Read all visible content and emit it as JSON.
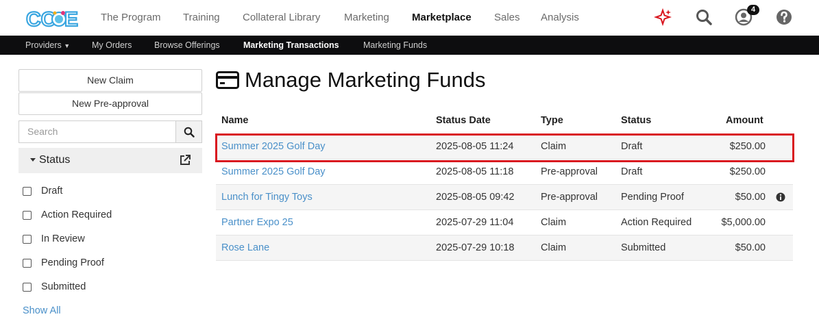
{
  "brand": {
    "logo_text": "CCoE",
    "logo_colors": [
      "#3aa6e0",
      "#e0337a",
      "#f2b01e",
      "#5cc0e8"
    ]
  },
  "topnav": {
    "items": [
      "The Program",
      "Training",
      "Collateral Library",
      "Marketing",
      "Marketplace",
      "Sales",
      "Analysis"
    ],
    "active": "Marketplace",
    "notifications_count": "4",
    "icons": [
      "sparkle-icon",
      "search-icon",
      "user-icon",
      "help-icon"
    ],
    "accent_color": "#d9161f"
  },
  "subnav": {
    "items": [
      "Providers",
      "My Orders",
      "Browse Offerings",
      "Marketing Transactions",
      "Marketing Funds"
    ],
    "active": "Marketing Transactions"
  },
  "sidebar": {
    "new_claim": "New Claim",
    "new_preapproval": "New Pre-approval",
    "search_placeholder": "Search",
    "status_label": "Status",
    "filters": [
      "Draft",
      "Action Required",
      "In Review",
      "Pending Proof",
      "Submitted"
    ],
    "show_all": "Show All"
  },
  "main": {
    "title": "Manage Marketing Funds",
    "columns": [
      "Name",
      "Status Date",
      "Type",
      "Status",
      "Amount"
    ],
    "rows": [
      {
        "name": "Summer 2025 Golf Day",
        "date": "2025-08-05 11:24",
        "type": "Claim",
        "status": "Draft",
        "amount": "$250.00"
      },
      {
        "name": "Summer 2025 Golf Day",
        "date": "2025-08-05 11:18",
        "type": "Pre-approval",
        "status": "Draft",
        "amount": "$250.00"
      },
      {
        "name": "Lunch for Tingy Toys",
        "date": "2025-08-05 09:42",
        "type": "Pre-approval",
        "status": "Pending Proof",
        "amount": "$50.00"
      },
      {
        "name": "Partner Expo 25",
        "date": "2025-07-29 11:04",
        "type": "Claim",
        "status": "Action Required",
        "amount": "$5,000.00"
      },
      {
        "name": "Rose Lane",
        "date": "2025-07-29 10:18",
        "type": "Claim",
        "status": "Submitted",
        "amount": "$50.00"
      }
    ],
    "highlight_color": "#d9161f",
    "link_color": "#4a90c9"
  }
}
